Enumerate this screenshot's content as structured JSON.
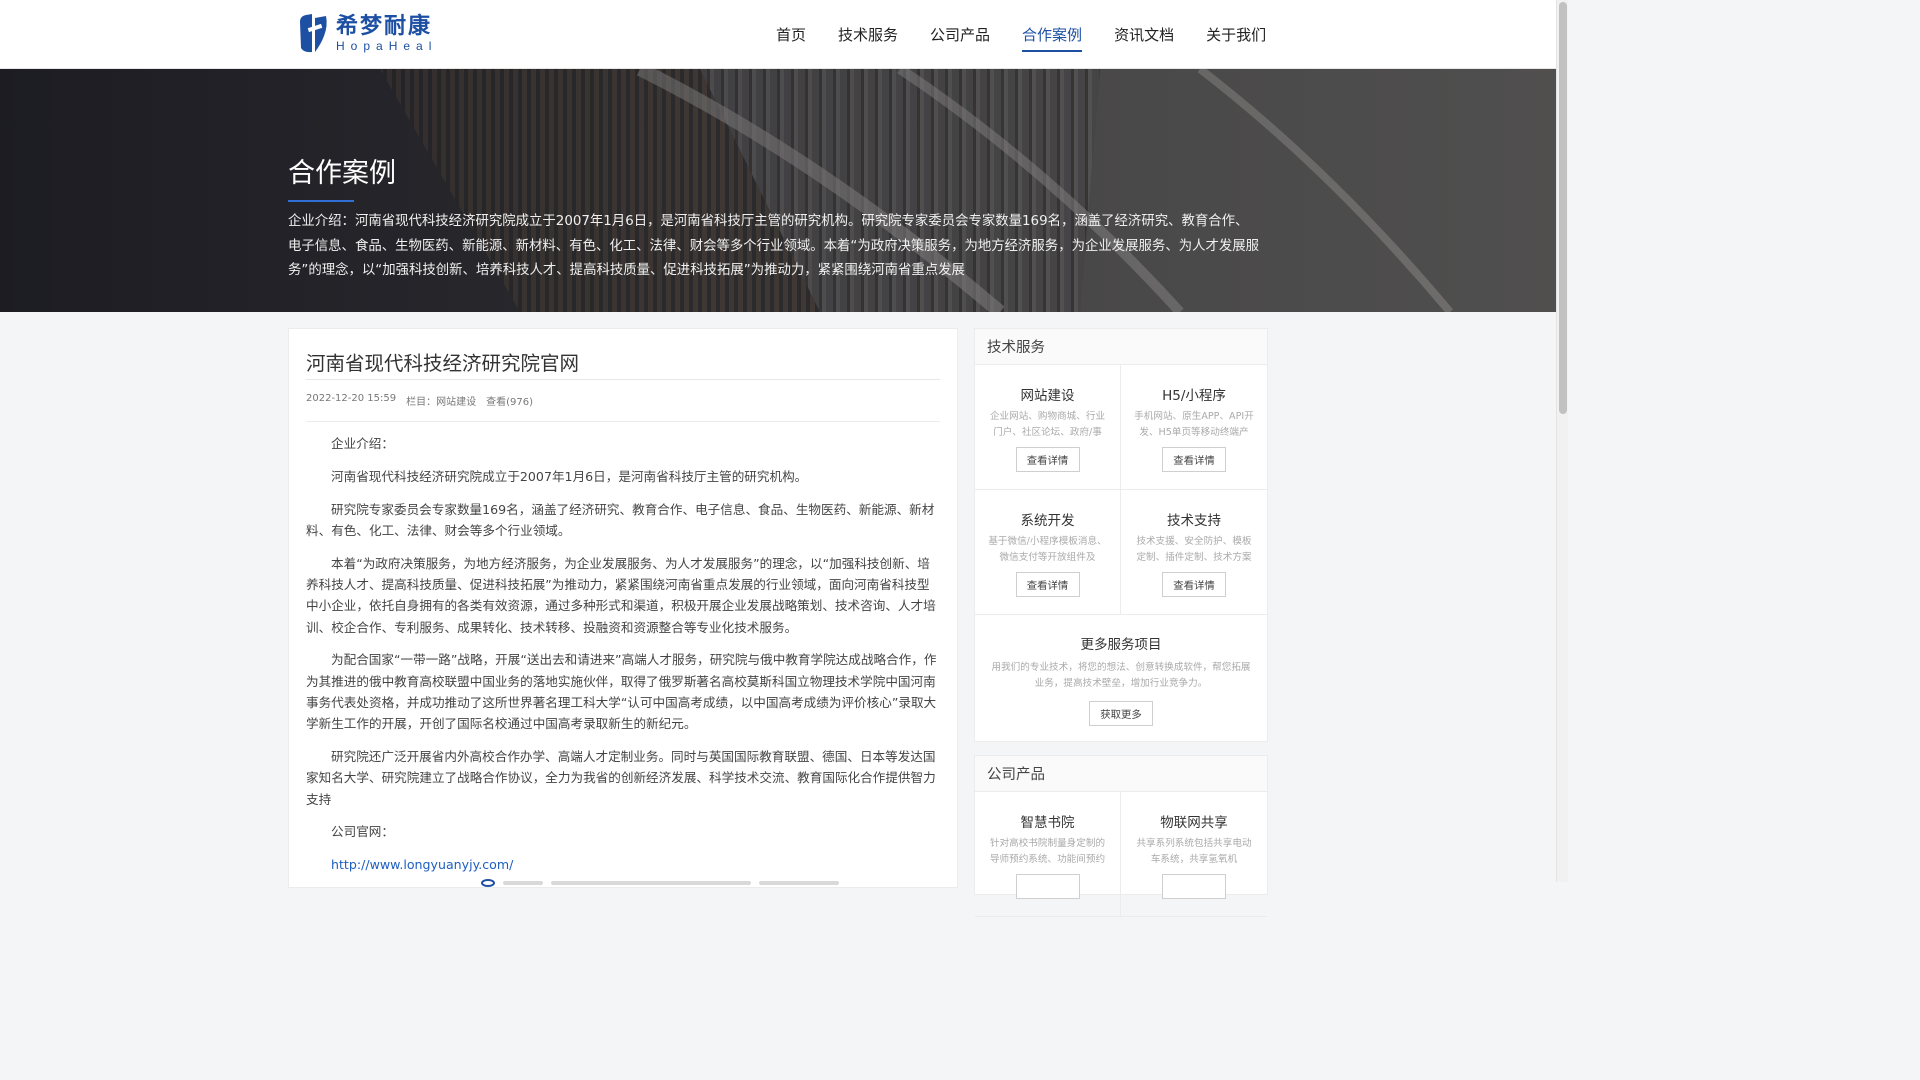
{
  "brand": {
    "name_cn": "希梦耐康",
    "name_en": "HopaHeal",
    "color": "#1d4fa3"
  },
  "nav": {
    "items": [
      {
        "label": "首页"
      },
      {
        "label": "技术服务"
      },
      {
        "label": "公司产品"
      },
      {
        "label": "合作案例",
        "active": true
      },
      {
        "label": "资讯文档"
      },
      {
        "label": "关于我们"
      }
    ]
  },
  "banner": {
    "title": "合作案例",
    "description": "企业介绍：河南省现代科技经济研究院成立于2007年1月6日，是河南省科技厅主管的研究机构。研究院专家委员会专家数量169名，涵盖了经济研究、教育合作、电子信息、食品、生物医药、新能源、新材料、有色、化工、法律、财会等多个行业领域。本着“为政府决策服务，为地方经济服务，为企业发展服务、为人才发展服务”的理念，以“加强科技创新、培养科技人才、提高科技质量、促进科技拓展”为推动力，紧紧围绕河南省重点发展"
  },
  "article": {
    "title": "河南省现代科技经济研究院官网",
    "date": "2022-12-20 15:59",
    "category_label": "栏目：",
    "category": "网站建设",
    "views": "查看(976)",
    "paragraphs": [
      "企业介绍：",
      "河南省现代科技经济研究院成立于2007年1月6日，是河南省科技厅主管的研究机构。",
      "研究院专家委员会专家数量169名，涵盖了经济研究、教育合作、电子信息、食品、生物医药、新能源、新材料、有色、化工、法律、财会等多个行业领域。",
      "本着“为政府决策服务，为地方经济服务，为企业发展服务、为人才发展服务”的理念，以“加强科技创新、培养科技人才、提高科技质量、促进科技拓展”为推动力，紧紧围绕河南省重点发展的行业领域，面向河南省科技型中小企业，依托自身拥有的各类有效资源，通过多种形式和渠道，积极开展企业发展战略策划、技术咨询、人才培训、校企合作、专利服务、成果转化、技术转移、投融资和资源整合等专业化技术服务。",
      "为配合国家“一带一路”战略，开展“送出去和请进来”高端人才服务，研究院与俄中教育学院达成战略合作，作为其推进的俄中教育高校联盟中国业务的落地实施伙伴，取得了俄罗斯著名高校莫斯科国立物理技术学院中国河南事务代表处资格，并成功推动了这所世界著名理工科大学“认可中国高考成绩，以中国高考成绩为评价核心”录取大学新生工作的开展，开创了国际名校通过中国高考录取新生的新纪元。",
      "研究院还广泛开展省内外高校合作办学、高端人才定制业务。同时与英国国际教育联盟、德国、日本等发达国家知名大学、研究院建立了战略合作协议，全力为我省的创新经济发展、科学技术交流、教育国际化合作提供智力支持",
      "公司官网："
    ],
    "link": "http://www.longyuanyjy.com/"
  },
  "sidebar": {
    "services": {
      "heading": "技术服务",
      "cards": [
        {
          "title": "网站建设",
          "desc": "企业网站、购物商城、行业门户、社区论坛、政府/事",
          "button": "查看详情"
        },
        {
          "title": "H5/小程序",
          "desc": "手机网站、原生APP、API开发、H5单页等移动终端产",
          "button": "查看详情"
        },
        {
          "title": "系统开发",
          "desc": "基于微信/小程序模板消息、微信支付等开放组件及",
          "button": "查看详情"
        },
        {
          "title": "技术支持",
          "desc": "技术支援、安全防护、模板定制、插件定制、技术方案",
          "button": "查看详情"
        }
      ],
      "more": {
        "title": "更多服务项目",
        "desc": "用我们的专业技术，将您的想法、创意转换成软件，帮您拓展业务，提高技术壁垒，增加行业竞争力。",
        "button": "获取更多"
      }
    },
    "products": {
      "heading": "公司产品",
      "cards": [
        {
          "title": "智慧书院",
          "desc": "针对高校书院制量身定制的导师预约系统、功能间预约"
        },
        {
          "title": "物联网共享",
          "desc": "共享系列系统包括共享电动车系统，共享氢氧机"
        }
      ]
    }
  }
}
